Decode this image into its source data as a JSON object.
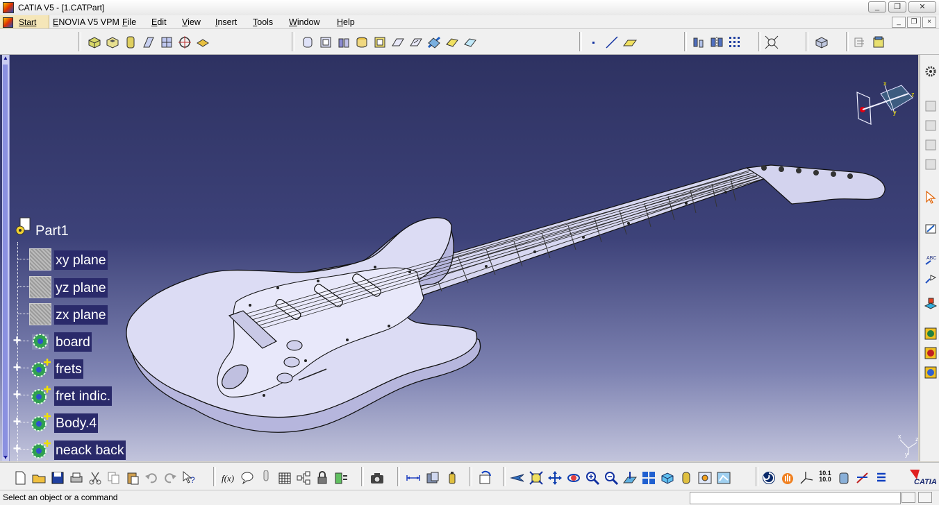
{
  "window": {
    "title": "CATIA V5 - [1.CATPart]",
    "controls": [
      "_",
      "❐",
      "✕"
    ]
  },
  "menu": {
    "start": "Start",
    "items": [
      "ENOVIA V5 VPM",
      "File",
      "Edit",
      "View",
      "Insert",
      "Tools",
      "Window",
      "Help"
    ],
    "doc_controls": [
      "_",
      "❐",
      "×"
    ]
  },
  "tree": {
    "root": "Part1",
    "nodes": [
      {
        "label": "xy plane",
        "icon": "plane-icon",
        "expandable": false
      },
      {
        "label": "yz plane",
        "icon": "plane-icon",
        "expandable": false
      },
      {
        "label": "zx plane",
        "icon": "plane-icon",
        "expandable": false
      },
      {
        "label": "board",
        "icon": "body-icon",
        "expandable": true
      },
      {
        "label": "frets",
        "icon": "body-icon",
        "expandable": true
      },
      {
        "label": "fret indic.",
        "icon": "body-icon",
        "expandable": true
      },
      {
        "label": "Body.4",
        "icon": "body-icon",
        "expandable": true
      },
      {
        "label": "neack back",
        "icon": "body-icon",
        "expandable": true
      }
    ]
  },
  "compass": {
    "labels": [
      "x",
      "y",
      "z"
    ]
  },
  "mini_axis": {
    "labels": [
      "x",
      "y",
      "z"
    ]
  },
  "status": {
    "message": "Select an object or a command"
  },
  "bottom_toolbar": {
    "ratio_top": "10.1",
    "ratio_bottom": "10.0"
  },
  "brand": {
    "logo_text": "CATIA"
  },
  "colors": {
    "viewport_top": "#2e3262",
    "viewport_bottom": "#c2c4dc",
    "model": "#d0d0ee",
    "tree_label_bg": "#2a2a6a"
  }
}
